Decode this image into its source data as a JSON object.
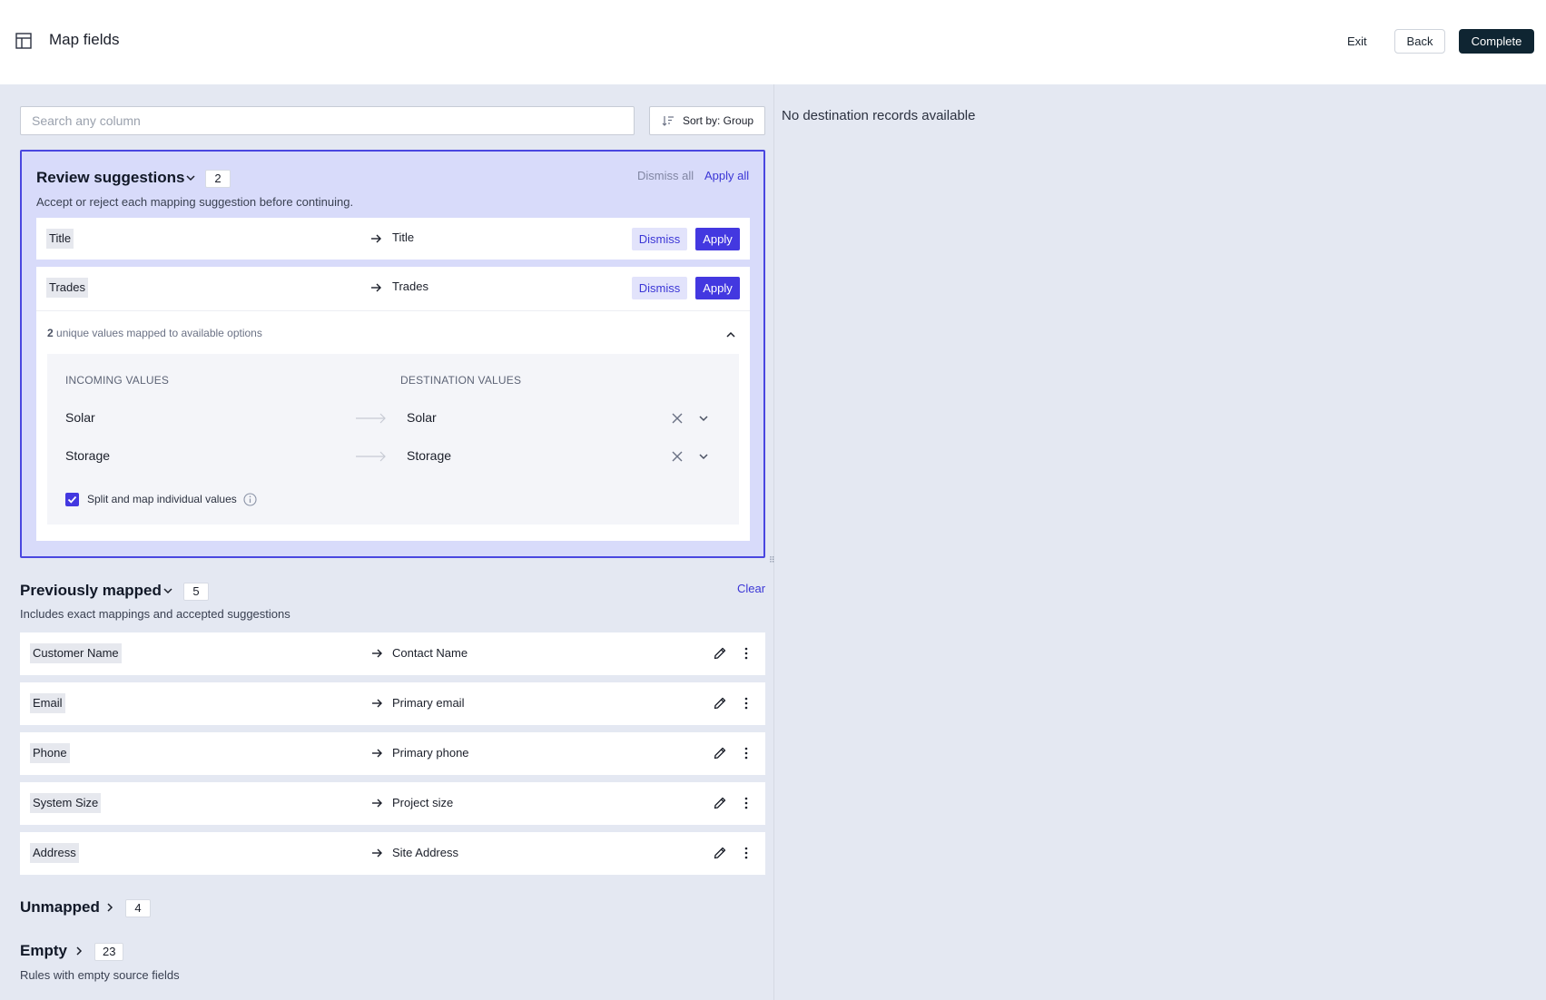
{
  "header": {
    "title": "Map fields",
    "exit_label": "Exit",
    "back_label": "Back",
    "complete_label": "Complete"
  },
  "toolbar": {
    "search_placeholder": "Search any column",
    "sort_label": "Sort by: Group"
  },
  "right_panel": {
    "message": "No destination records available"
  },
  "review": {
    "title": "Review suggestions",
    "count": "2",
    "description": "Accept or reject each mapping suggestion before continuing.",
    "dismiss_all": "Dismiss all",
    "apply_all": "Apply all",
    "dismiss_label": "Dismiss",
    "apply_label": "Apply",
    "rows": [
      {
        "source": "Title",
        "destination": "Title"
      },
      {
        "source": "Trades",
        "destination": "Trades"
      }
    ],
    "unique_count": "2",
    "unique_text": "unique values mapped to available options",
    "incoming_header": "INCOMING VALUES",
    "destination_header": "DESTINATION VALUES",
    "values": [
      {
        "incoming": "Solar",
        "destination": "Solar"
      },
      {
        "incoming": "Storage",
        "destination": "Storage"
      }
    ],
    "split_label": "Split and map individual values",
    "split_checked": true
  },
  "previous": {
    "title": "Previously mapped",
    "count": "5",
    "description": "Includes exact mappings and accepted suggestions",
    "clear_label": "Clear",
    "rows": [
      {
        "source": "Customer Name",
        "destination": "Contact Name"
      },
      {
        "source": "Email",
        "destination": "Primary email"
      },
      {
        "source": "Phone",
        "destination": "Primary phone"
      },
      {
        "source": "System Size",
        "destination": "Project size"
      },
      {
        "source": "Address",
        "destination": "Site Address"
      }
    ]
  },
  "unmapped": {
    "title": "Unmapped",
    "count": "4"
  },
  "empty": {
    "title": "Empty",
    "count": "23",
    "description": "Rules with empty source fields"
  },
  "colors": {
    "accent": "#4338e0",
    "complete_button": "#0f2532",
    "review_background": "#d8dbfa",
    "page_background": "#e4e8f2"
  }
}
